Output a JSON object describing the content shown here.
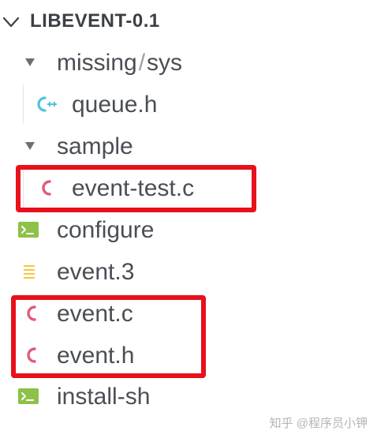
{
  "explorer": {
    "title": "LIBEVENT-0.1",
    "items": [
      {
        "label": "missing",
        "label_extra": "sys",
        "kind": "folder",
        "expanded": true,
        "icon": "chevron-down-icon"
      },
      {
        "label": "queue.h",
        "kind": "file",
        "icon": "cpp-header-icon",
        "icon_color": "#4fc3dc"
      },
      {
        "label": "sample",
        "kind": "folder",
        "expanded": true,
        "icon": "chevron-down-icon"
      },
      {
        "label": "event-test.c",
        "kind": "file",
        "icon": "c-file-icon",
        "icon_color": "#e25a7a"
      },
      {
        "label": "configure",
        "kind": "file",
        "icon": "terminal-icon",
        "icon_color": "#8dc149"
      },
      {
        "label": "event.3",
        "kind": "file",
        "icon": "text-lines-icon",
        "icon_color": "#f2c94c"
      },
      {
        "label": "event.c",
        "kind": "file",
        "icon": "c-file-icon",
        "icon_color": "#e25a7a"
      },
      {
        "label": "event.h",
        "kind": "file",
        "icon": "c-file-icon",
        "icon_color": "#e25a7a"
      },
      {
        "label": "install-sh",
        "kind": "file",
        "icon": "terminal-icon",
        "icon_color": "#8dc149"
      }
    ]
  },
  "annotation": {
    "color": "#e8101b"
  },
  "watermark": {
    "text": "知乎 @程序员小钾"
  }
}
